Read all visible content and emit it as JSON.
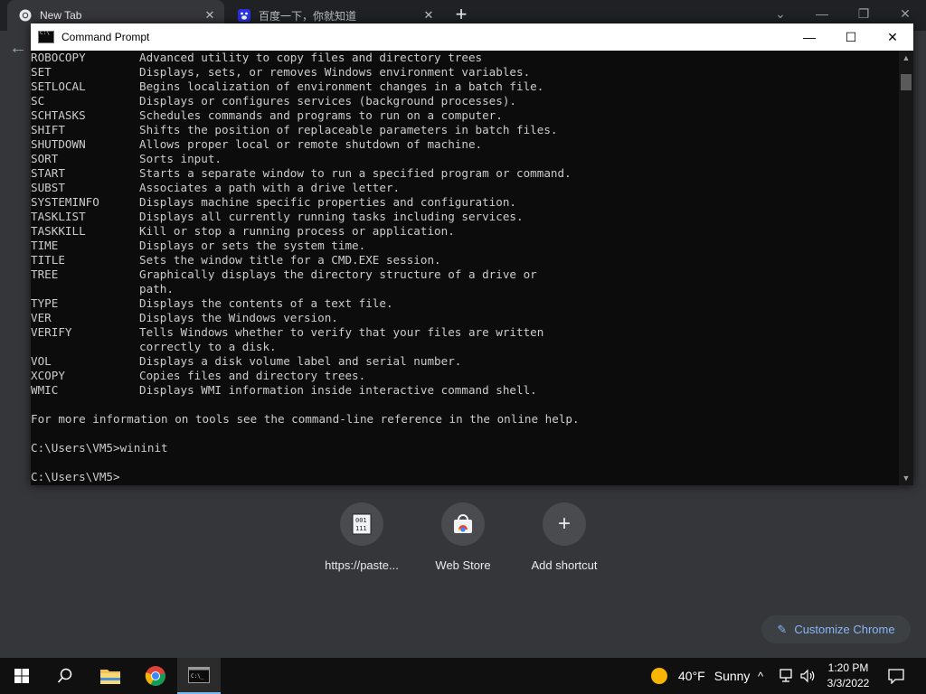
{
  "browser": {
    "tabs": [
      {
        "title": "New Tab",
        "close": "✕"
      },
      {
        "title": "百度一下，你就知道",
        "close": "✕"
      }
    ],
    "new_tab_glyph": "+",
    "window_controls": {
      "dropdown": "⌄",
      "minimize": "—",
      "restore": "❐",
      "close": "✕"
    },
    "back_glyph": "←"
  },
  "cmd": {
    "title": "Command Prompt",
    "controls": {
      "minimize": "—",
      "maximize": "☐",
      "close": "✕"
    },
    "commands": [
      {
        "name": "ROBOCOPY",
        "desc": "Advanced utility to copy files and directory trees"
      },
      {
        "name": "SET",
        "desc": "Displays, sets, or removes Windows environment variables."
      },
      {
        "name": "SETLOCAL",
        "desc": "Begins localization of environment changes in a batch file."
      },
      {
        "name": "SC",
        "desc": "Displays or configures services (background processes)."
      },
      {
        "name": "SCHTASKS",
        "desc": "Schedules commands and programs to run on a computer."
      },
      {
        "name": "SHIFT",
        "desc": "Shifts the position of replaceable parameters in batch files."
      },
      {
        "name": "SHUTDOWN",
        "desc": "Allows proper local or remote shutdown of machine."
      },
      {
        "name": "SORT",
        "desc": "Sorts input."
      },
      {
        "name": "START",
        "desc": "Starts a separate window to run a specified program or command."
      },
      {
        "name": "SUBST",
        "desc": "Associates a path with a drive letter."
      },
      {
        "name": "SYSTEMINFO",
        "desc": "Displays machine specific properties and configuration."
      },
      {
        "name": "TASKLIST",
        "desc": "Displays all currently running tasks including services."
      },
      {
        "name": "TASKKILL",
        "desc": "Kill or stop a running process or application."
      },
      {
        "name": "TIME",
        "desc": "Displays or sets the system time."
      },
      {
        "name": "TITLE",
        "desc": "Sets the window title for a CMD.EXE session."
      },
      {
        "name": "TREE",
        "desc": "Graphically displays the directory structure of a drive or"
      },
      {
        "name": "",
        "desc": "path."
      },
      {
        "name": "TYPE",
        "desc": "Displays the contents of a text file."
      },
      {
        "name": "VER",
        "desc": "Displays the Windows version."
      },
      {
        "name": "VERIFY",
        "desc": "Tells Windows whether to verify that your files are written"
      },
      {
        "name": "",
        "desc": "correctly to a disk."
      },
      {
        "name": "VOL",
        "desc": "Displays a disk volume label and serial number."
      },
      {
        "name": "XCOPY",
        "desc": "Copies files and directory trees."
      },
      {
        "name": "WMIC",
        "desc": "Displays WMI information inside interactive command shell."
      }
    ],
    "help_line": "For more information on tools see the command-line reference in the online help.",
    "prompt_command": "C:\\Users\\VM5>wininit",
    "prompt": "C:\\Users\\VM5>"
  },
  "shortcuts": [
    {
      "label": "https://paste...",
      "icon": "document-binary-icon"
    },
    {
      "label": "Web Store",
      "icon": "web-store-icon"
    },
    {
      "label": "Add shortcut",
      "icon": "plus-icon",
      "glyph": "+"
    }
  ],
  "customize_label": "Customize Chrome",
  "taskbar": {
    "weather_temp": "40°F",
    "weather_text": "Sunny",
    "time": "1:20 PM",
    "date": "3/3/2022",
    "chevron": "^"
  },
  "colors": {
    "cmd_bg": "#0c0c0c",
    "cmd_text": "#cccccc",
    "accent": "#8ab4f8",
    "chrome_bg": "#35363a"
  }
}
